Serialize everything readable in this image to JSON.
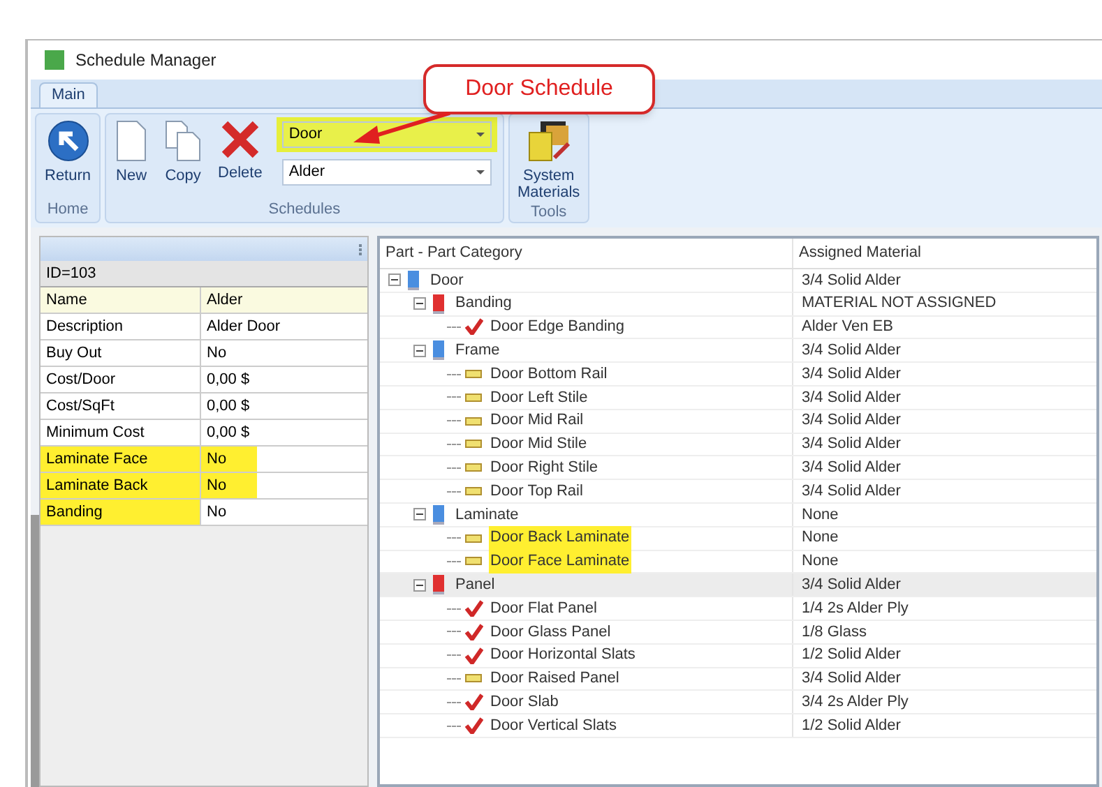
{
  "window": {
    "title": "Schedule Manager"
  },
  "ribbon": {
    "tabs": [
      {
        "label": "Main",
        "selected": true
      }
    ],
    "groups": [
      {
        "label": "Home",
        "items": [
          {
            "kind": "return",
            "label": "Return"
          }
        ]
      },
      {
        "label": "Schedules",
        "items": [
          {
            "kind": "new",
            "label": "New"
          },
          {
            "kind": "copy",
            "label": "Copy"
          },
          {
            "kind": "delete",
            "label": "Delete"
          },
          {
            "kind": "combos",
            "combos": [
              {
                "value": "Door",
                "highlighted": true
              },
              {
                "value": "Alder",
                "highlighted": false
              }
            ]
          }
        ]
      },
      {
        "label": "Tools",
        "items": [
          {
            "kind": "materials",
            "label": "System Materials"
          }
        ]
      }
    ]
  },
  "callout": {
    "text": "Door Schedule"
  },
  "properties": {
    "header": "ID=103",
    "rows": [
      {
        "name": "Name",
        "value": "Alder",
        "selected": true,
        "highlighted": false
      },
      {
        "name": "Description",
        "value": "Alder Door",
        "selected": false,
        "highlighted": false
      },
      {
        "name": "Buy Out",
        "value": "No",
        "selected": false,
        "highlighted": false
      },
      {
        "name": "Cost/Door",
        "value": "0,00 $",
        "selected": false,
        "highlighted": false
      },
      {
        "name": "Cost/SqFt",
        "value": "0,00 $",
        "selected": false,
        "highlighted": false
      },
      {
        "name": "Minimum Cost",
        "value": "0,00 $",
        "selected": false,
        "highlighted": false
      },
      {
        "name": "Laminate Face",
        "value": "No",
        "selected": false,
        "highlighted": true
      },
      {
        "name": "Laminate Back",
        "value": "No",
        "selected": false,
        "highlighted": true
      },
      {
        "name": "Banding",
        "value": "No",
        "selected": false,
        "highlighted": true
      }
    ]
  },
  "tree": {
    "columns": [
      "Part - Part Category",
      "Assigned Material"
    ],
    "items": [
      {
        "kind": "group",
        "color": "#4a8ee0",
        "label": "Door",
        "material": "3/4 Solid Alder",
        "expanded": true,
        "selected": false,
        "highlighted": false,
        "children": [
          {
            "kind": "group",
            "color": "#e03030",
            "label": "Banding",
            "material": "MATERIAL NOT ASSIGNED",
            "expanded": true,
            "selected": false,
            "highlighted": false,
            "children": [
              {
                "kind": "check",
                "label": "Door Edge Banding",
                "material": "Alder Ven EB",
                "selected": false,
                "highlighted": false
              }
            ]
          },
          {
            "kind": "group",
            "color": "#4a8ee0",
            "label": "Frame",
            "material": "3/4 Solid Alder",
            "expanded": true,
            "selected": false,
            "highlighted": false,
            "children": [
              {
                "kind": "bar",
                "label": "Door Bottom Rail",
                "material": "3/4 Solid Alder",
                "selected": false,
                "highlighted": false
              },
              {
                "kind": "bar",
                "label": "Door Left Stile",
                "material": "3/4 Solid Alder",
                "selected": false,
                "highlighted": false
              },
              {
                "kind": "bar",
                "label": "Door Mid Rail",
                "material": "3/4 Solid Alder",
                "selected": false,
                "highlighted": false
              },
              {
                "kind": "bar",
                "label": "Door Mid Stile",
                "material": "3/4 Solid Alder",
                "selected": false,
                "highlighted": false
              },
              {
                "kind": "bar",
                "label": "Door Right Stile",
                "material": "3/4 Solid Alder",
                "selected": false,
                "highlighted": false
              },
              {
                "kind": "bar",
                "label": "Door Top Rail",
                "material": "3/4 Solid Alder",
                "selected": false,
                "highlighted": false
              }
            ]
          },
          {
            "kind": "group",
            "color": "#4a8ee0",
            "label": "Laminate",
            "material": "None",
            "expanded": true,
            "selected": false,
            "highlighted": false,
            "children": [
              {
                "kind": "bar",
                "label": "Door Back Laminate",
                "material": "None",
                "selected": false,
                "highlighted": true
              },
              {
                "kind": "bar",
                "label": "Door Face Laminate",
                "material": "None",
                "selected": false,
                "highlighted": true
              }
            ]
          },
          {
            "kind": "group",
            "color": "#e03030",
            "label": "Panel",
            "material": "3/4 Solid Alder",
            "expanded": true,
            "selected": true,
            "highlighted": false,
            "children": [
              {
                "kind": "check",
                "label": "Door Flat Panel",
                "material": "1/4 2s Alder Ply",
                "selected": false,
                "highlighted": false
              },
              {
                "kind": "check",
                "label": "Door Glass Panel",
                "material": "1/8 Glass",
                "selected": false,
                "highlighted": false
              },
              {
                "kind": "check",
                "label": "Door Horizontal Slats",
                "material": "1/2 Solid Alder",
                "selected": false,
                "highlighted": false
              },
              {
                "kind": "bar",
                "label": "Door Raised Panel",
                "material": "3/4 Solid Alder",
                "selected": false,
                "highlighted": false
              },
              {
                "kind": "check",
                "label": "Door Slab",
                "material": "3/4 2s Alder Ply",
                "selected": false,
                "highlighted": false
              },
              {
                "kind": "check",
                "label": "Door Vertical Slats",
                "material": "1/2 Solid Alder",
                "selected": false,
                "highlighted": false
              }
            ]
          }
        ]
      }
    ]
  }
}
